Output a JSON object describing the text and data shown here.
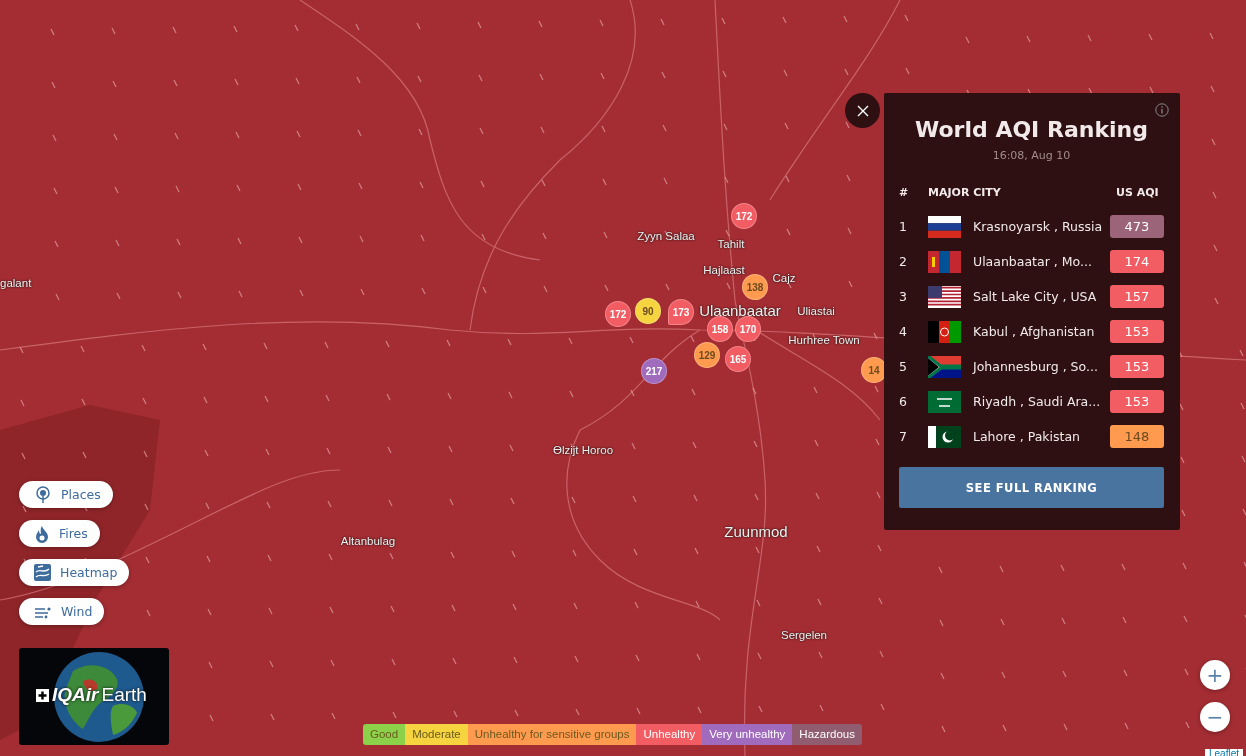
{
  "map": {
    "places": [
      {
        "name": "galant",
        "kind": "town"
      },
      {
        "name": "Zyyn Salaa",
        "kind": "town"
      },
      {
        "name": "Tahilt",
        "kind": "town"
      },
      {
        "name": "Hajlaast",
        "kind": "town"
      },
      {
        "name": "Cajz",
        "kind": "town"
      },
      {
        "name": "Ulaanbaatar",
        "kind": "city"
      },
      {
        "name": "Uliastai",
        "kind": "town"
      },
      {
        "name": "Hurhree Town",
        "kind": "town"
      },
      {
        "name": "Ɵlzijt Horoo",
        "kind": "town"
      },
      {
        "name": "Altanbulag",
        "kind": "town"
      },
      {
        "name": "Zuunmod",
        "kind": "city"
      },
      {
        "name": "Sergelen",
        "kind": "town"
      }
    ],
    "markers": [
      {
        "value": "172",
        "color": "#f25c63",
        "kind": "circle"
      },
      {
        "value": "172",
        "color": "#f25c63",
        "kind": "circle"
      },
      {
        "value": "90",
        "color": "#f5d43f",
        "kind": "circle"
      },
      {
        "value": "173",
        "color": "#f25c63",
        "kind": "pin"
      },
      {
        "value": "138",
        "color": "#ff9a4f",
        "kind": "circle"
      },
      {
        "value": "158",
        "color": "#f25c63",
        "kind": "circle"
      },
      {
        "value": "170",
        "color": "#f25c63",
        "kind": "circle"
      },
      {
        "value": "129",
        "color": "#ff9a4f",
        "kind": "circle"
      },
      {
        "value": "165",
        "color": "#f25c63",
        "kind": "circle"
      },
      {
        "value": "217",
        "color": "#a06bbd",
        "kind": "circle"
      },
      {
        "value": "14",
        "color": "#ff9a4f",
        "kind": "circle"
      }
    ],
    "attribution": "Leaflet"
  },
  "layers": [
    {
      "label": "Places",
      "kind": "places"
    },
    {
      "label": "Fires",
      "kind": "fires"
    },
    {
      "label": "Heatmap",
      "kind": "heatmap"
    },
    {
      "label": "Wind",
      "kind": "wind"
    }
  ],
  "logo": {
    "brand": "IQAir",
    "product": "Earth"
  },
  "ranking": {
    "title": "World AQI Ranking",
    "time": "16:08, Aug 10",
    "columns": [
      "#",
      "MAJOR CITY",
      "US AQI"
    ],
    "rows": [
      {
        "rank": "1",
        "kind": "russia",
        "city": "Krasnoyarsk , Russia",
        "aqi": "473",
        "color": "#9b6478"
      },
      {
        "rank": "2",
        "kind": "mongolia",
        "city": "Ulaanbaatar , Mo...",
        "aqi": "174",
        "color": "#f25c63"
      },
      {
        "rank": "3",
        "kind": "usa",
        "city": "Salt Lake City , USA",
        "aqi": "157",
        "color": "#f25c63"
      },
      {
        "rank": "4",
        "kind": "afghanistan",
        "city": "Kabul , Afghanistan",
        "aqi": "153",
        "color": "#f25c63"
      },
      {
        "rank": "5",
        "kind": "southafrica",
        "city": "Johannesburg , So...",
        "aqi": "153",
        "color": "#f25c63"
      },
      {
        "rank": "6",
        "kind": "saudi",
        "city": "Riyadh , Saudi Ara...",
        "aqi": "153",
        "color": "#f25c63"
      },
      {
        "rank": "7",
        "kind": "pakistan",
        "city": "Lahore , Pakistan",
        "aqi": "148",
        "color": "#ff9a4f"
      }
    ],
    "button": "SEE FULL RANKING"
  },
  "legend": [
    {
      "label": "Good",
      "color": "#8bd14a"
    },
    {
      "label": "Moderate",
      "color": "#f5d43f"
    },
    {
      "label": "Unhealthy for sensitive groups",
      "color": "#ff9a4f"
    },
    {
      "label": "Unhealthy",
      "color": "#f25c63"
    },
    {
      "label": "Very unhealthy",
      "color": "#a06bbd"
    },
    {
      "label": "Hazardous",
      "color": "#8f5d6f"
    }
  ],
  "zoom": [
    "+",
    "−"
  ]
}
